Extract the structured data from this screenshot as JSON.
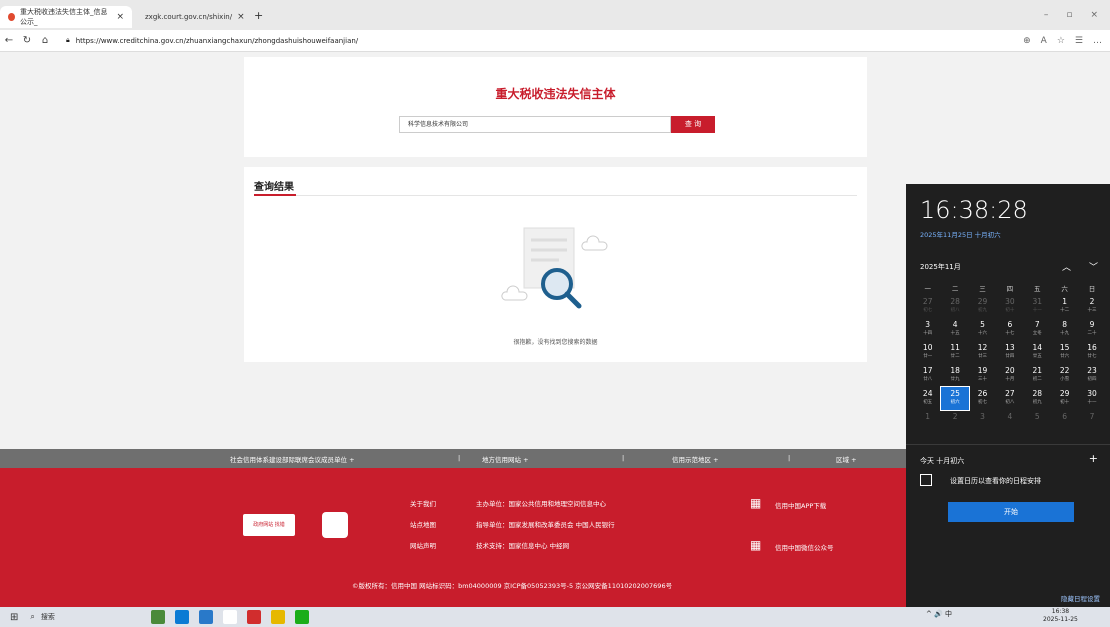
{
  "browser": {
    "tabs": [
      {
        "label": "重大税收违法失信主体_信息公示_"
      },
      {
        "label": "zxgk.court.gov.cn/shixin/"
      }
    ],
    "url": "https://www.creditchina.gov.cn/zhuanxiangchaxun/zhongdashuishouweifaanjian/"
  },
  "search": {
    "title": "重大税收违法失信主体",
    "value": "科学信息技术有限公司",
    "button": "查 询"
  },
  "results": {
    "title": "查询结果",
    "empty_text": "很抱歉，没有找到您搜索的数据"
  },
  "footer_bar": {
    "items": [
      "社会信用体系建设部际联席会议成员单位 +",
      "|",
      "地方信用网站 +",
      "|",
      "信用示范地区 +",
      "|",
      "区域 +"
    ]
  },
  "footer": {
    "links": [
      "关于我们",
      "站点地图",
      "网站声明"
    ],
    "info": [
      "主办单位：国家公共信用和地理空间信息中心",
      "指导单位：国家发展和改革委员会 中国人民银行",
      "技术支持：国家信息中心 中经网"
    ],
    "app": [
      "信用中国APP下载",
      "信用中国微信公众号"
    ],
    "copyright": "©版权所有：信用中国   网站标识码：bm04000009   京ICP备05052393号-5   京公网安备11010202007696号",
    "logo1_text": "政府网站 找错"
  },
  "calendar": {
    "time": "16:38:28",
    "date": "2025年11月25日 十月初六",
    "month": "2025年11月",
    "weekdays": [
      "一",
      "二",
      "三",
      "四",
      "五",
      "六",
      "日"
    ],
    "rows": [
      [
        [
          "27",
          "初七",
          true
        ],
        [
          "28",
          "初八",
          true
        ],
        [
          "29",
          "初九",
          true
        ],
        [
          "30",
          "初十",
          true
        ],
        [
          "31",
          "十一",
          true
        ],
        [
          "1",
          "十二",
          false
        ],
        [
          "2",
          "十三",
          false
        ]
      ],
      [
        [
          "3",
          "十四",
          false
        ],
        [
          "4",
          "十五",
          false
        ],
        [
          "5",
          "十六",
          false
        ],
        [
          "6",
          "十七",
          false
        ],
        [
          "7",
          "立冬",
          false
        ],
        [
          "8",
          "十九",
          false
        ],
        [
          "9",
          "二十",
          false
        ]
      ],
      [
        [
          "10",
          "廿一",
          false
        ],
        [
          "11",
          "廿二",
          false
        ],
        [
          "12",
          "廿三",
          false
        ],
        [
          "13",
          "廿四",
          false
        ],
        [
          "14",
          "廿五",
          false
        ],
        [
          "15",
          "廿六",
          false
        ],
        [
          "16",
          "廿七",
          false
        ]
      ],
      [
        [
          "17",
          "廿八",
          false
        ],
        [
          "18",
          "廿九",
          false
        ],
        [
          "19",
          "三十",
          false
        ],
        [
          "20",
          "十月",
          false
        ],
        [
          "21",
          "初二",
          false
        ],
        [
          "22",
          "小雪",
          false
        ],
        [
          "23",
          "初四",
          false
        ]
      ],
      [
        [
          "24",
          "初五",
          false
        ],
        [
          "25",
          "初六",
          false
        ],
        [
          "26",
          "初七",
          false
        ],
        [
          "27",
          "初八",
          false
        ],
        [
          "28",
          "初九",
          false
        ],
        [
          "29",
          "初十",
          false
        ],
        [
          "30",
          "十一",
          false
        ]
      ],
      [
        [
          "1",
          "",
          true
        ],
        [
          "2",
          "",
          true
        ],
        [
          "3",
          "",
          true
        ],
        [
          "4",
          "",
          true
        ],
        [
          "5",
          "",
          true
        ],
        [
          "6",
          "",
          true
        ],
        [
          "7",
          "",
          true
        ]
      ]
    ],
    "today_label": "今天 十月初六",
    "tip": "设置日历以查看你的日程安排",
    "start_button": "开始",
    "hide": "隐藏日程设置"
  },
  "taskbar": {
    "search": "搜索",
    "tray": "^ 🔊 中",
    "clock_time": "16:38",
    "clock_date": "2025-11-25"
  }
}
